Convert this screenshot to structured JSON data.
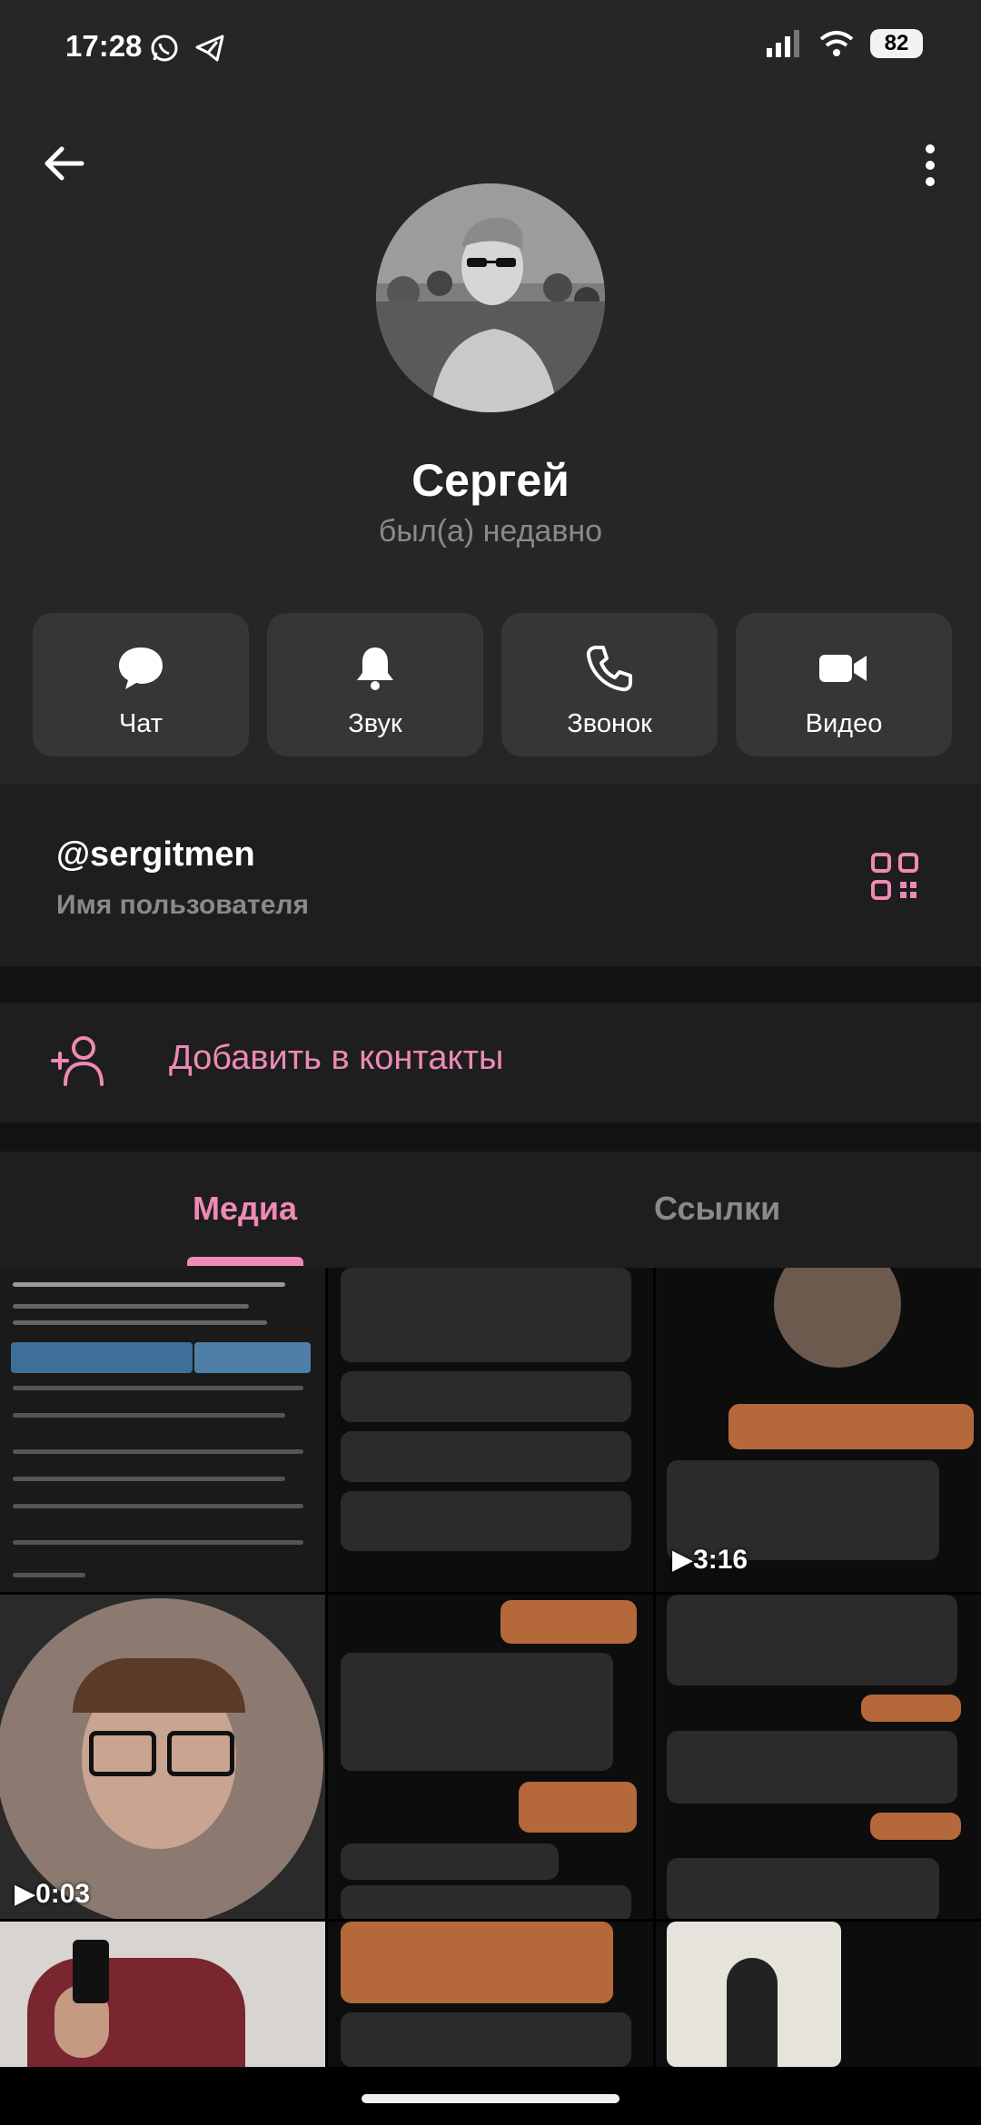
{
  "status_bar": {
    "time": "17:28",
    "battery": "82"
  },
  "profile": {
    "name": "Сергей",
    "status": "был(а) недавно"
  },
  "actions": [
    {
      "label": "Чат",
      "icon": "chat-bubble-icon"
    },
    {
      "label": "Звук",
      "icon": "bell-icon"
    },
    {
      "label": "Звонок",
      "icon": "phone-icon"
    },
    {
      "label": "Видео",
      "icon": "video-camera-icon"
    }
  ],
  "info": {
    "username": "@sergitmen",
    "username_caption": "Имя пользователя"
  },
  "add_contact": {
    "label": "Добавить в контакты"
  },
  "tabs": {
    "media": "Медиа",
    "links": "Ссылки"
  },
  "media": {
    "durations": [
      "3:16",
      "0:03"
    ]
  },
  "colors": {
    "accent": "#ee8ab4",
    "background": "#1c1c1e",
    "header": "#262626",
    "button": "#363638",
    "muted": "#8a8a8e"
  }
}
